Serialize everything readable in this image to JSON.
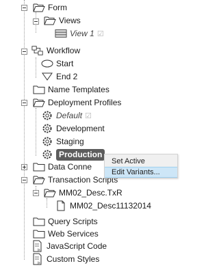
{
  "tree": {
    "form": "Form",
    "views": "Views",
    "view1": "View 1",
    "workflow": "Workflow",
    "start": "Start",
    "end2": "End 2",
    "name_templates": "Name Templates",
    "deployment_profiles": "Deployment Profiles",
    "default": "Default",
    "development": "Development",
    "staging": "Staging",
    "production": "Production",
    "data_connections": "Data Conne",
    "transaction_scripts": "Transaction Scripts",
    "mm02_desc_txr": "MM02_Desc.TxR",
    "mm02_desc_file": "MM02_Desc11132014",
    "query_scripts": "Query Scripts",
    "web_services": "Web Services",
    "javascript_code": "JavaScript Code",
    "custom_styles": "Custom Styles"
  },
  "context_menu": {
    "set_active": "Set Active",
    "edit_variants": "Edit Variants..."
  },
  "colors": {
    "selection_bg": "#5c5c5c",
    "menu_highlight": "#cde6f7"
  }
}
